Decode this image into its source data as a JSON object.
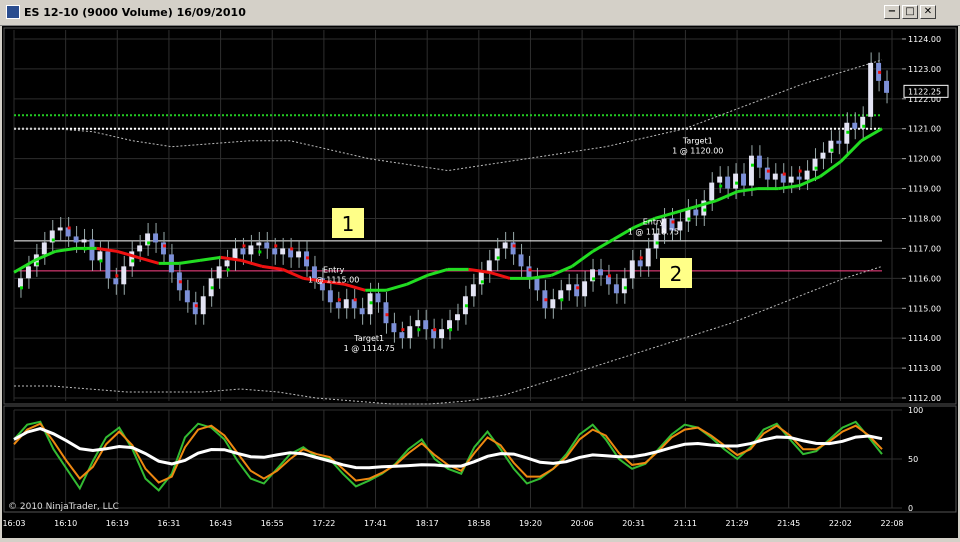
{
  "window": {
    "title": "ES 12-10 (9000 Volume)  16/09/2010",
    "buttons": [
      "−",
      "□",
      "✕"
    ]
  },
  "colors": {
    "background": "#000000",
    "grid": "#2e2e2e",
    "up_candle": "#e4e4f4",
    "down_candle": "#7d90d8",
    "ma_up": "#22dd22",
    "ma_down": "#ee1111",
    "dots": "#00e000",
    "level_white": "#ffffff",
    "level_green": "#22cc22",
    "level_pink": "#ff4488",
    "callout_bg": "#ffff88",
    "stoch_green": "#33bb33",
    "stoch_orange": "#ee8811",
    "stoch_white": "#ffffff"
  },
  "chart_data": {
    "type": "candlestick",
    "instrument": "ES 12-10",
    "bar_type": "9000 Volume",
    "date": "16/09/2010",
    "y_axis": {
      "ticks": [
        "1124.00",
        "1123.00",
        "1122.00",
        "1121.00",
        "1120.00",
        "1119.00",
        "1118.00",
        "1117.00",
        "1116.00",
        "1115.00",
        "1114.00",
        "1113.00",
        "1112.00"
      ],
      "ylim": [
        1111.9,
        1124.3
      ],
      "last_price": "1122.25"
    },
    "x_axis": {
      "labels": [
        "16:03",
        "16:10",
        "16:19",
        "16:31",
        "16:43",
        "16:55",
        "17:22",
        "17:41",
        "18:17",
        "18:58",
        "19:20",
        "20:06",
        "20:31",
        "21:11",
        "21:29",
        "21:45",
        "22:02",
        "22:08"
      ]
    },
    "price_path": [
      1116.0,
      1116.4,
      1116.8,
      1117.2,
      1117.6,
      1117.7,
      1117.4,
      1117.2,
      1117.3,
      1116.6,
      1116.9,
      1116.0,
      1115.8,
      1116.4,
      1116.9,
      1117.1,
      1117.5,
      1117.2,
      1116.8,
      1116.2,
      1115.6,
      1115.2,
      1114.8,
      1115.4,
      1116.0,
      1116.4,
      1116.6,
      1117.0,
      1116.8,
      1117.1,
      1117.2,
      1117.0,
      1116.8,
      1117.0,
      1116.7,
      1116.9,
      1116.4,
      1116.0,
      1115.6,
      1115.2,
      1115.0,
      1115.3,
      1115.0,
      1114.8,
      1115.5,
      1115.2,
      1114.5,
      1114.2,
      1114.0,
      1114.4,
      1114.6,
      1114.3,
      1114.0,
      1114.3,
      1114.6,
      1114.8,
      1115.4,
      1115.8,
      1116.2,
      1116.6,
      1117.0,
      1117.2,
      1116.8,
      1116.4,
      1116.0,
      1115.6,
      1115.0,
      1115.3,
      1115.6,
      1115.8,
      1115.4,
      1115.9,
      1116.3,
      1116.1,
      1115.8,
      1115.5,
      1116.0,
      1116.6,
      1116.4,
      1117.0,
      1117.5,
      1118.0,
      1117.6,
      1117.9,
      1118.3,
      1118.1,
      1118.6,
      1119.2,
      1119.4,
      1119.0,
      1119.5,
      1119.1,
      1120.1,
      1119.7,
      1119.3,
      1119.5,
      1119.2,
      1119.4,
      1119.3,
      1119.6,
      1120.0,
      1120.2,
      1120.6,
      1120.5,
      1121.2,
      1121.0,
      1121.4,
      1123.2,
      1122.6,
      1122.2
    ],
    "ma_path": [
      1116.2,
      1116.6,
      1116.9,
      1117.0,
      1117.0,
      1116.9,
      1116.7,
      1116.5,
      1116.5,
      1116.6,
      1116.7,
      1116.6,
      1116.4,
      1116.3,
      1116.0,
      1115.9,
      1115.8,
      1115.6,
      1115.6,
      1115.8,
      1116.1,
      1116.3,
      1116.3,
      1116.2,
      1116.0,
      1116.0,
      1116.1,
      1116.4,
      1116.9,
      1117.3,
      1117.7,
      1118.0,
      1118.2,
      1118.4,
      1118.6,
      1118.9,
      1119.0,
      1119.0,
      1119.1,
      1119.4,
      1119.9,
      1120.6,
      1121.0
    ],
    "lower_band": [
      1112.4,
      1112.4,
      1112.3,
      1112.2,
      1112.2,
      1112.2,
      1112.3,
      1112.2,
      1112.0,
      1111.9,
      1111.8,
      1111.8,
      1111.9,
      1112.1,
      1112.5,
      1112.9,
      1113.3,
      1113.7,
      1114.1,
      1114.5,
      1115.0,
      1115.5,
      1116.0,
      1116.4
    ],
    "upper_band": [
      1121.0,
      1121.0,
      1120.9,
      1120.6,
      1120.4,
      1120.5,
      1120.6,
      1120.6,
      1120.3,
      1120.0,
      1119.8,
      1119.6,
      1119.8,
      1120.0,
      1120.2,
      1120.4,
      1120.7,
      1121.0,
      1121.5,
      1122.0,
      1122.5,
      1122.9,
      1123.3
    ],
    "levels": [
      {
        "price": 1121.45,
        "color": "level_green",
        "style": "dotted"
      },
      {
        "price": 1121.0,
        "color": "level_white",
        "style": "dotted"
      },
      {
        "price": 1117.25,
        "color": "level_white",
        "style": "solid"
      },
      {
        "price": 1116.25,
        "color": "level_pink",
        "style": "solid"
      }
    ],
    "annotations": [
      {
        "label": "Entry",
        "detail": "1 @ 1115.00",
        "price": 1116.2,
        "x_ratio": 0.36
      },
      {
        "label": "Target1",
        "detail": "1 @ 1114.75",
        "price": 1113.9,
        "x_ratio": 0.4
      },
      {
        "label": "Entry",
        "detail": "1 @ 1118.75",
        "price": 1117.8,
        "x_ratio": 0.72
      },
      {
        "label": "Target1",
        "detail": "1 @ 1120.00",
        "price": 1120.5,
        "x_ratio": 0.77
      }
    ],
    "callouts": [
      "1",
      "2"
    ],
    "stochastic": {
      "ticks": [
        "100",
        "50",
        "0"
      ],
      "green": [
        70,
        85,
        88,
        60,
        40,
        20,
        48,
        72,
        82,
        60,
        30,
        18,
        35,
        72,
        86,
        82,
        70,
        48,
        30,
        25,
        40,
        55,
        62,
        52,
        50,
        35,
        22,
        28,
        35,
        45,
        60,
        70,
        50,
        40,
        35,
        62,
        78,
        60,
        40,
        25,
        30,
        40,
        55,
        75,
        85,
        70,
        50,
        40,
        45,
        60,
        75,
        85,
        82,
        72,
        60,
        50,
        62,
        80,
        86,
        70,
        55,
        58,
        70,
        82,
        88,
        72,
        55
      ],
      "orange": [
        65,
        80,
        86,
        68,
        48,
        30,
        42,
        65,
        78,
        64,
        40,
        26,
        32,
        62,
        80,
        84,
        74,
        56,
        38,
        30,
        38,
        50,
        60,
        55,
        52,
        40,
        28,
        30,
        36,
        44,
        56,
        66,
        54,
        44,
        38,
        56,
        72,
        64,
        46,
        32,
        32,
        40,
        52,
        70,
        80,
        74,
        56,
        44,
        46,
        58,
        72,
        80,
        82,
        74,
        64,
        54,
        60,
        76,
        84,
        74,
        60,
        60,
        68,
        78,
        84,
        74,
        60
      ]
    },
    "copyright": "© 2010 NinjaTrader, LLC"
  }
}
